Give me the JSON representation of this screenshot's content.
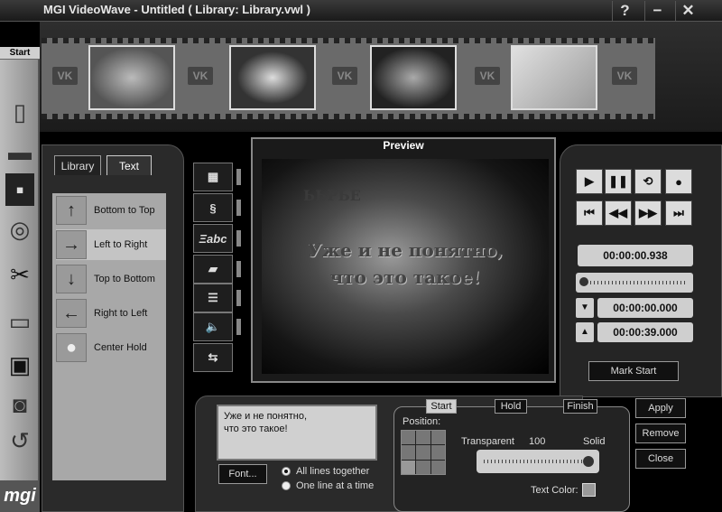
{
  "window": {
    "title": "MGI VideoWave - Untitled ( Library: Library.vwl )",
    "help": "?",
    "minimize": "−",
    "close": "✕"
  },
  "sidebar": {
    "start_label": "Start",
    "brand": "mgi"
  },
  "tabs": {
    "library": "Library",
    "text": "Text"
  },
  "motion_items": [
    {
      "label": "Bottom to Top",
      "icon": "↑"
    },
    {
      "label": "Left to Right",
      "icon": "→"
    },
    {
      "label": "Top to Bottom",
      "icon": "↓"
    },
    {
      "label": "Right to Left",
      "icon": "←"
    },
    {
      "label": "Center Hold",
      "icon": "●"
    }
  ],
  "preview": {
    "title": "Preview",
    "overlay_line1": "Уже и не понятно,",
    "overlay_line2": "что это такое!",
    "faint_sign": "ЬЬРЬЕ"
  },
  "transport": {
    "current_time": "00:00:00.938",
    "start_time": "00:00:00.000",
    "end_time": "00:00:39.000",
    "mark_start": "Mark Start"
  },
  "actions": {
    "apply": "Apply",
    "remove": "Remove",
    "close": "Close"
  },
  "text_panel": {
    "text_line1": "Уже и не понятно,",
    "text_line2": "что это такое!",
    "font_button": "Font...",
    "radio_all": "All lines together",
    "radio_one": "One line at a time"
  },
  "settings": {
    "tab_start": "Start",
    "tab_hold": "Hold",
    "tab_finish": "Finish",
    "position_label": "Position:",
    "transparent_label": "Transparent",
    "transparency_value": "100",
    "solid_label": "Solid",
    "text_color_label": "Text Color:"
  }
}
